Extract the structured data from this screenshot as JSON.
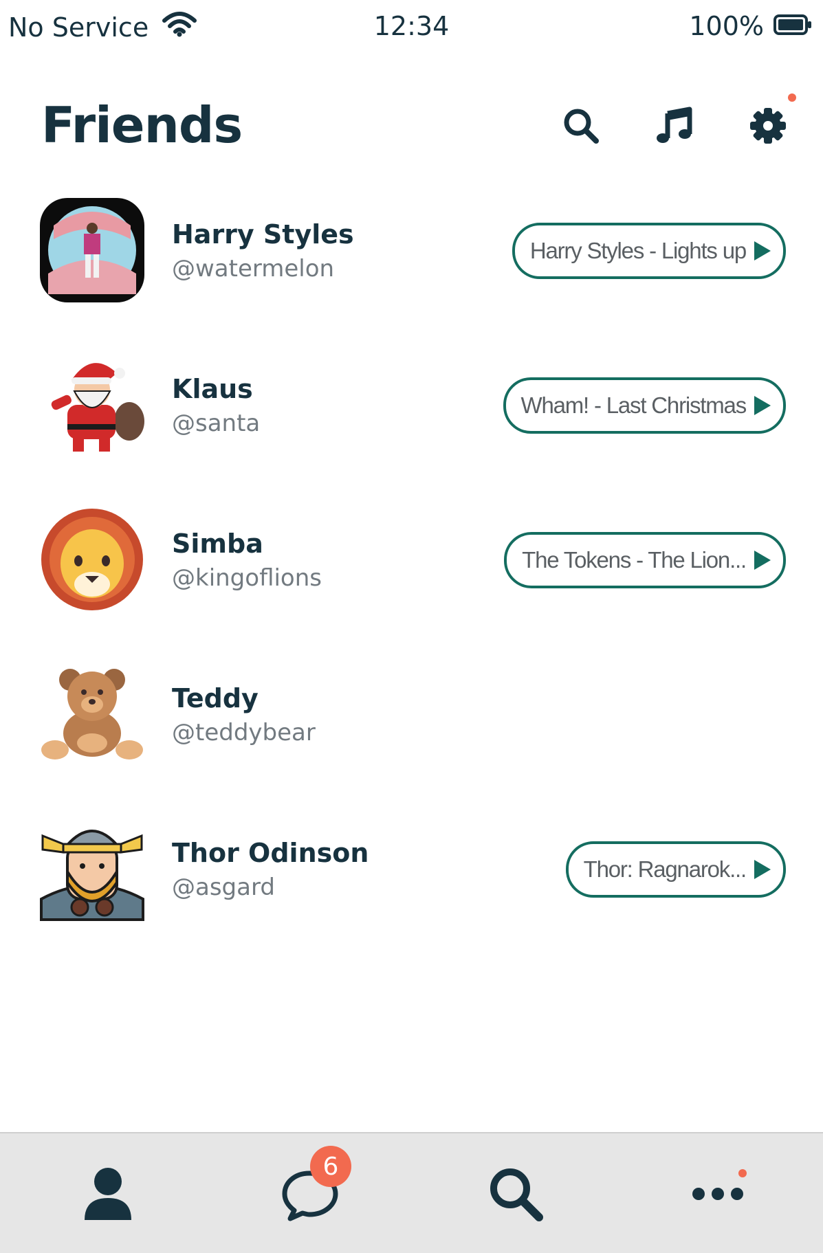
{
  "status_bar": {
    "carrier": "No Service",
    "time": "12:34",
    "battery": "100%"
  },
  "header": {
    "title": "Friends",
    "icons": [
      "search-icon",
      "music-note-icon",
      "gear-icon"
    ]
  },
  "friends": [
    {
      "name": "Harry Styles",
      "handle": "@watermelon",
      "song": "Harry Styles - Lights up",
      "avatar": "concert-photo"
    },
    {
      "name": "Klaus",
      "handle": "@santa",
      "song": "Wham! - Last Christmas",
      "avatar": "santa-avatar"
    },
    {
      "name": "Simba",
      "handle": "@kingoflions",
      "song": "The Tokens - The Lion...",
      "avatar": "lion-avatar"
    },
    {
      "name": "Teddy",
      "handle": "@teddybear",
      "song": "",
      "avatar": "teddy-bear-avatar"
    },
    {
      "name": "Thor Odinson",
      "handle": "@asgard",
      "song": "Thor: Ragnarok...",
      "avatar": "viking-avatar"
    }
  ],
  "bottom_nav": {
    "items": [
      "profile-icon",
      "chat-icon",
      "search-icon",
      "more-icon"
    ],
    "chat_badge": "6"
  },
  "colors": {
    "primary_dark": "#17323f",
    "accent_green": "#146d60",
    "notification": "#f26a4f",
    "nav_background": "#e6e6e6"
  }
}
